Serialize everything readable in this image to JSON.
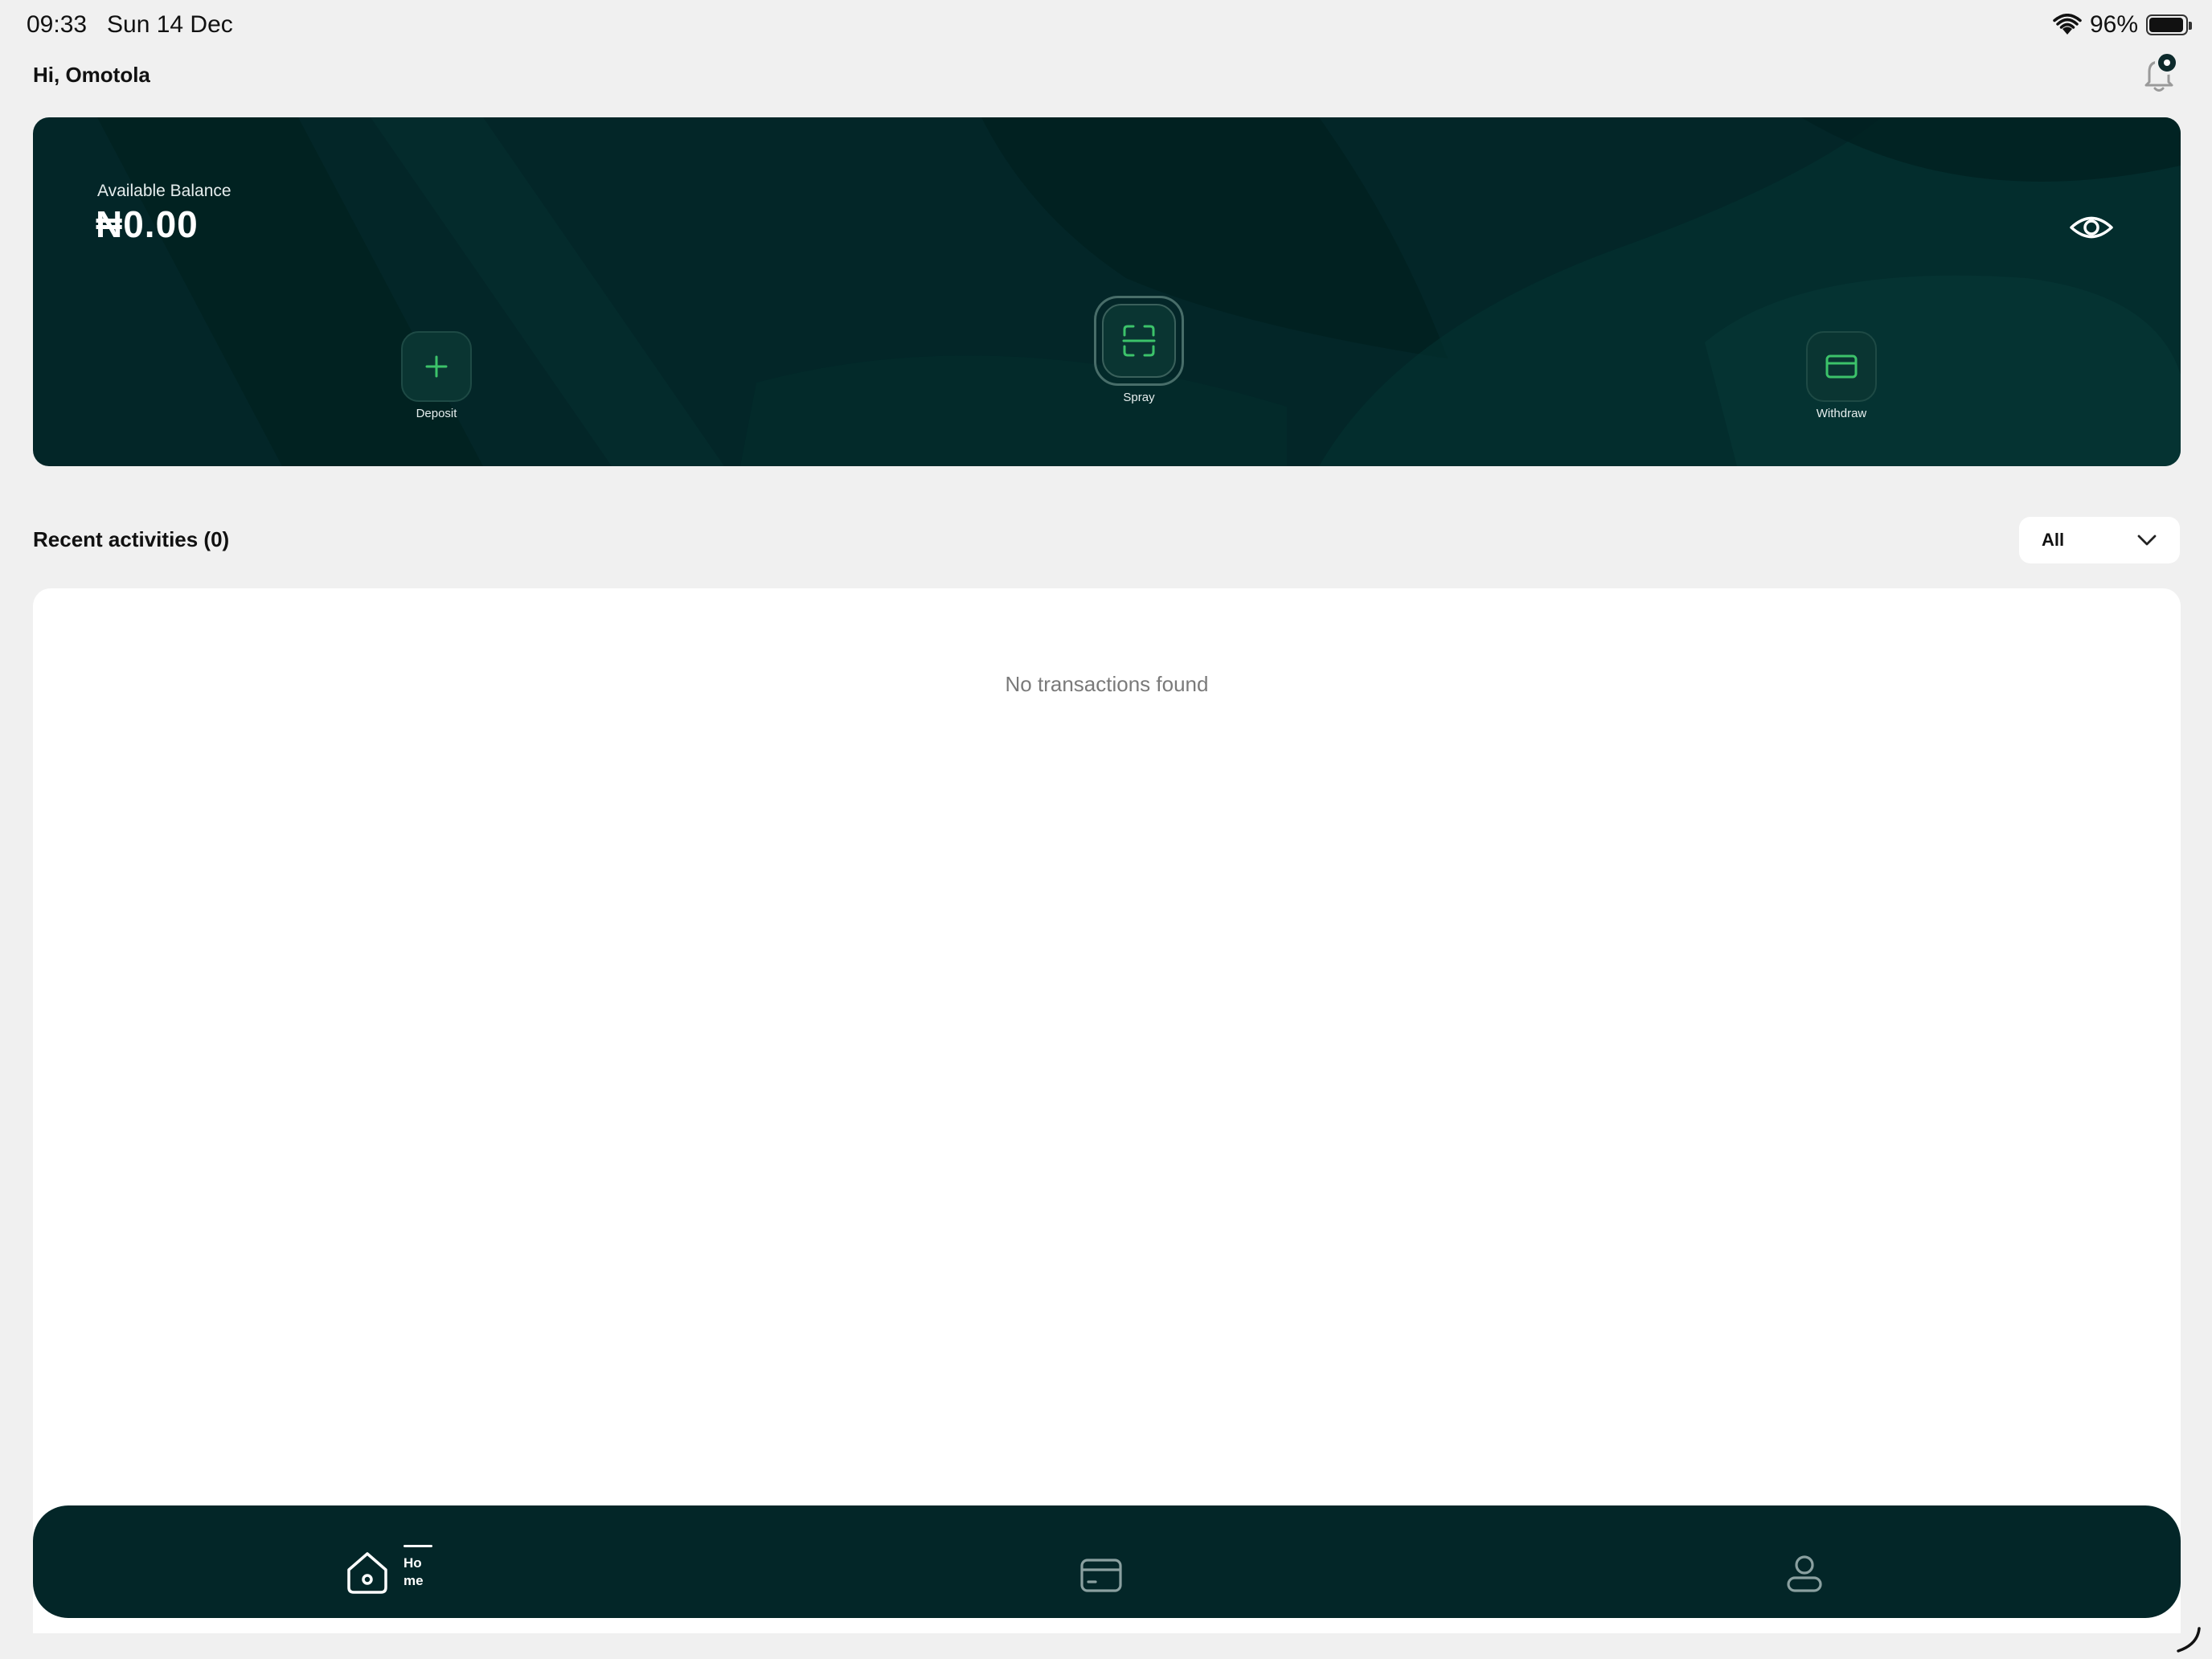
{
  "status_bar": {
    "time": "09:33",
    "date": "Sun 14 Dec",
    "battery": "96%",
    "battery_level": 0.96
  },
  "header": {
    "greeting": "Hi, Omotola"
  },
  "balance_card": {
    "label": "Available Balance",
    "amount": "₦0.00",
    "actions": [
      {
        "label": "Deposit",
        "icon": "plus-icon"
      },
      {
        "label": "Spray",
        "icon": "scan-icon"
      },
      {
        "label": "Withdraw",
        "icon": "card-icon"
      }
    ]
  },
  "recent": {
    "title": "Recent activities (0)",
    "filter": {
      "selected": "All"
    },
    "empty_message": "No transactions found"
  },
  "nav": {
    "items": [
      {
        "label_line1": "Ho",
        "label_line2": "me",
        "icon": "home-icon",
        "active": true
      },
      {
        "icon": "card-icon",
        "active": false
      },
      {
        "icon": "profile-icon",
        "active": false
      }
    ]
  },
  "colors": {
    "card_bg": "#032628",
    "accent_green": "#3cc36a",
    "page_bg": "#f0f0f0"
  }
}
